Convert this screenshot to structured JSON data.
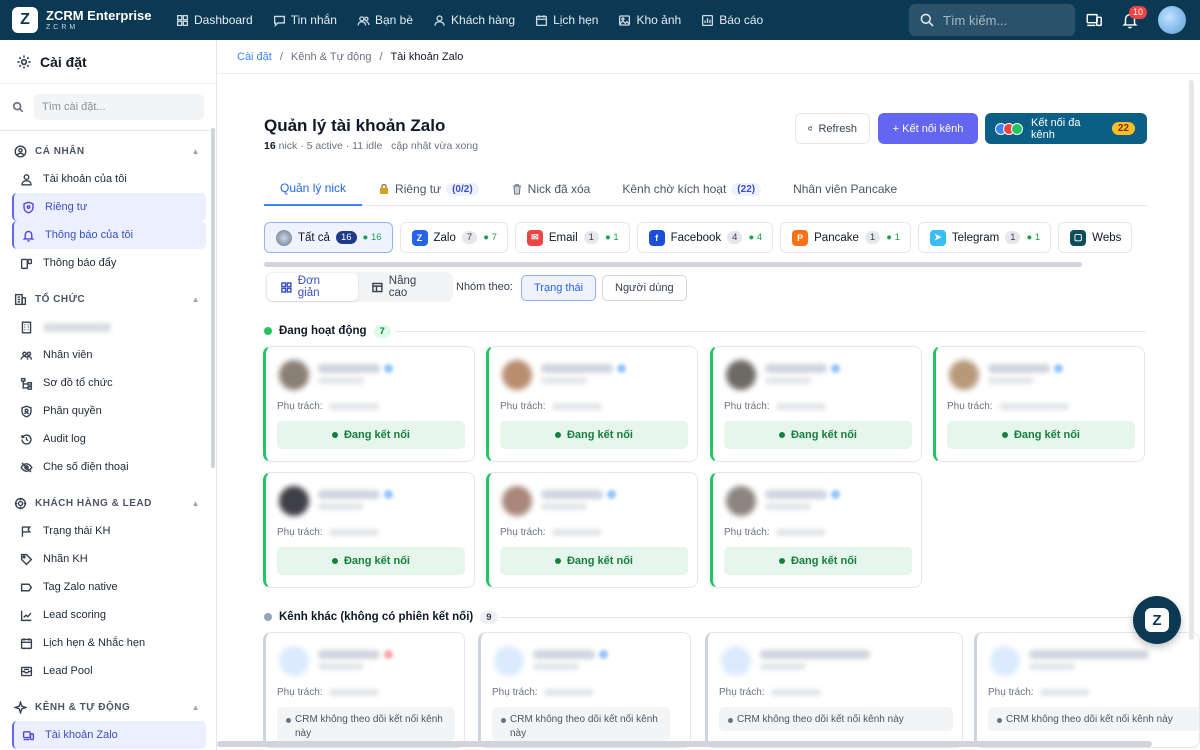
{
  "brand": {
    "name": "ZCRM Enterprise",
    "sub": "ZCRM",
    "logo": "Z"
  },
  "nav": [
    {
      "label": "Dashboard",
      "icon": "dashboard-icon"
    },
    {
      "label": "Tin nhắn",
      "icon": "message-icon"
    },
    {
      "label": "Bạn bè",
      "icon": "friends-icon"
    },
    {
      "label": "Khách hàng",
      "icon": "customer-icon"
    },
    {
      "label": "Lịch hẹn",
      "icon": "calendar-icon"
    },
    {
      "label": "Kho ảnh",
      "icon": "image-icon"
    },
    {
      "label": "Báo cáo",
      "icon": "report-icon"
    }
  ],
  "search": {
    "placeholder": "Tìm kiếm..."
  },
  "notifications": {
    "count": "10"
  },
  "sidebar": {
    "title": "Cài đặt",
    "search_placeholder": "Tìm cài đặt...",
    "sections": [
      {
        "title": "CÁ NHÂN",
        "items": [
          "Tài khoản của tôi",
          "Riêng tư",
          "Thông báo của tôi",
          "Thông báo đẩy"
        ]
      },
      {
        "title": "TỔ CHỨC",
        "items": [
          "",
          "Nhân viên",
          "Sơ đồ tổ chức",
          "Phân quyền",
          "Audit log",
          "Che số điện thoại"
        ]
      },
      {
        "title": "KHÁCH HÀNG & LEAD",
        "items": [
          "Trạng thái KH",
          "Nhãn KH",
          "Tag Zalo native",
          "Lead scoring",
          "Lịch hẹn & Nhắc hẹn",
          "Lead Pool"
        ]
      },
      {
        "title": "KÊNH & TỰ ĐỘNG",
        "items": [
          "Tài khoản Zalo"
        ]
      }
    ]
  },
  "breadcrumb": [
    "Cài đặt",
    "Kênh & Tự động",
    "Tài khoản Zalo"
  ],
  "page": {
    "title": "Quản lý tài khoản Zalo",
    "nick_count": "16",
    "sub_rest": "nick · 5 active · 11 idle",
    "updated": "cập nhật vừa xong",
    "refresh_label": "Refresh",
    "connect_label": "+ Kết nối kênh",
    "multi_label": "Kết nối đa kênh",
    "multi_count": "22"
  },
  "tabs": [
    {
      "label": "Quản lý nick",
      "count": ""
    },
    {
      "label": "Riêng tư",
      "count": "(0/2)"
    },
    {
      "label": "Nick đã xóa",
      "count": ""
    },
    {
      "label": "Kênh chờ kích hoạt",
      "count": "(22)"
    },
    {
      "label": "Nhân viên Pancake",
      "count": ""
    }
  ],
  "channels": [
    {
      "label": "Tất cả",
      "total": "16",
      "active": "16",
      "color": "#9ca3af",
      "letter": ""
    },
    {
      "label": "Zalo",
      "total": "7",
      "active": "7",
      "color": "#2563eb",
      "letter": "Z"
    },
    {
      "label": "Email",
      "total": "1",
      "active": "1",
      "color": "#ef4444",
      "letter": "✉"
    },
    {
      "label": "Facebook",
      "total": "4",
      "active": "4",
      "color": "#1d4ed8",
      "letter": "f"
    },
    {
      "label": "Pancake",
      "total": "1",
      "active": "1",
      "color": "#f97316",
      "letter": "P"
    },
    {
      "label": "Telegram",
      "total": "1",
      "active": "1",
      "color": "#38bdf8",
      "letter": "➤"
    },
    {
      "label": "Webs",
      "total": "",
      "active": "",
      "color": "#0f4c5c",
      "letter": "▢"
    }
  ],
  "view": {
    "simple": "Đơn giản",
    "advanced": "Nâng cao",
    "group_by": "Nhóm theo:",
    "by_status": "Trạng thái",
    "by_user": "Người dùng"
  },
  "groups": {
    "active": {
      "label": "Đang hoạt động",
      "count": "7"
    },
    "other": {
      "label": "Kênh khác (không có phiên kết nối)",
      "count": "9"
    }
  },
  "card_labels": {
    "owner": "Phụ trách:",
    "connected": "Đang kết nối",
    "not_tracked_1": "CRM không theo dõi kết nối kênh này",
    "not_tracked_2": "CRM không theo dõi kết nối kênh này"
  },
  "colors": {
    "primary": "#6366f1",
    "topbar": "#0b3954",
    "success": "#22c55e"
  }
}
